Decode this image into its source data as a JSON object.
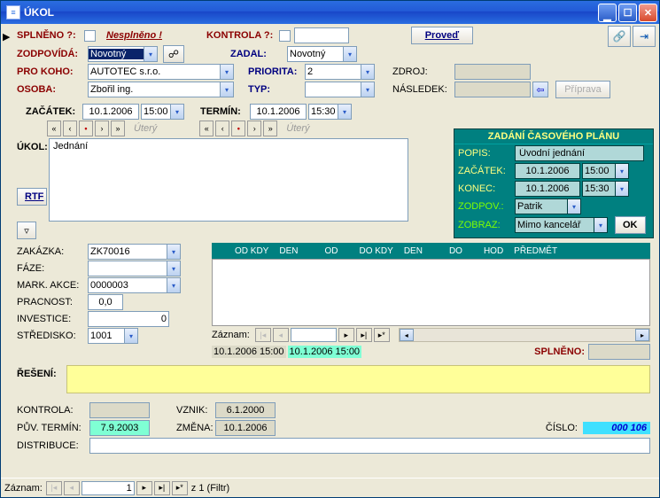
{
  "window": {
    "title": "ÚKOL"
  },
  "top": {
    "splneno_label": "SPLNĚNO ?:",
    "nesplneno_label": "Nesplněno !",
    "kontrola_label": "KONTROLA ?:",
    "proved_btn": "Proveď"
  },
  "fields": {
    "zodpovida_label": "ZODPOVÍDÁ:",
    "zodpovida_val": "Novotný",
    "prokoho_label": "PRO KOHO:",
    "prokoho_val": "AUTOTEC s.r.o.",
    "osoba_label": "OSOBA:",
    "osoba_val": "Zbořil ing.",
    "zadal_label": "ZADAL:",
    "zadal_val": "Novotný",
    "priorita_label": "PRIORITA:",
    "priorita_val": "2",
    "typ_label": "TYP:",
    "typ_val": "",
    "zdroj_label": "ZDROJ:",
    "nasledek_label": "NÁSLEDEK:",
    "priprava_btn": "Příprava"
  },
  "dates": {
    "zacatek_label": "ZAČÁTEK:",
    "zacatek_date": "10.1.2006",
    "zacatek_time": "15:00",
    "termin_label": "TERMÍN:",
    "termin_date": "10.1.2006",
    "termin_time": "15:30",
    "day1": "Úterý",
    "day2": "Úterý"
  },
  "task": {
    "ukol_label": "ÚKOL:",
    "ukol_text": "Jednání",
    "rtf_btn": "RTF"
  },
  "plan": {
    "title": "ZADÁNÍ ČASOVÉHO PLÁNU",
    "popis_label": "POPIS:",
    "popis_val": "Úvodní jednání",
    "zacatek_label": "ZAČÁTEK:",
    "zacatek_date": "10.1.2006",
    "zacatek_time": "15:00",
    "konec_label": "KONEC:",
    "konec_date": "10.1.2006",
    "konec_time": "15:30",
    "zodpov_label": "ZODPOV.:",
    "zodpov_val": "Patrik",
    "zobraz_label": "ZOBRAZ:",
    "zobraz_val": "Mimo kancelář",
    "ok_btn": "OK"
  },
  "left": {
    "zakazka_label": "ZAKÁZKA:",
    "zakazka_val": "ZK70016",
    "faze_label": "FÁZE:",
    "faze_val": "",
    "markakce_label": "MARK. AKCE:",
    "markakce_val": "0000003",
    "pracnost_label": "PRACNOST:",
    "pracnost_val": "0,0",
    "investice_label": "INVESTICE:",
    "investice_val": "0",
    "stredisko_label": "STŘEDISKO:",
    "stredisko_val": "1001"
  },
  "listheader": {
    "odkdy": "OD KDY",
    "den1": "DEN",
    "od": "OD",
    "dokdy": "DO KDY",
    "den2": "DEN",
    "do": "DO",
    "hod": "HOD",
    "predmet": "PŘEDMĚT"
  },
  "listnav": {
    "zaznam_label": "Záznam:"
  },
  "mid": {
    "ts1": "10.1.2006 15:00",
    "ts2": "10.1.2006 15:00",
    "splneno_label": "SPLNĚNO:"
  },
  "bottom": {
    "reseni_label": "ŘEŠENÍ:",
    "kontrola_label": "KONTROLA:",
    "kontrola_val": "",
    "puvtermin_label": "PŮV. TERMÍN:",
    "puvtermin_val": "7.9.2003",
    "distribuce_label": "DISTRIBUCE:",
    "vznik_label": "VZNIK:",
    "vznik_val": "6.1.2000",
    "zmena_label": "ZMĚNA:",
    "zmena_val": "10.1.2006",
    "cislo_label": "ČÍSLO:",
    "cislo_val": "000 106"
  },
  "statusbar": {
    "zaznam_label": "Záznam:",
    "pos": "1",
    "suffix": "z  1  (Filtr)"
  }
}
